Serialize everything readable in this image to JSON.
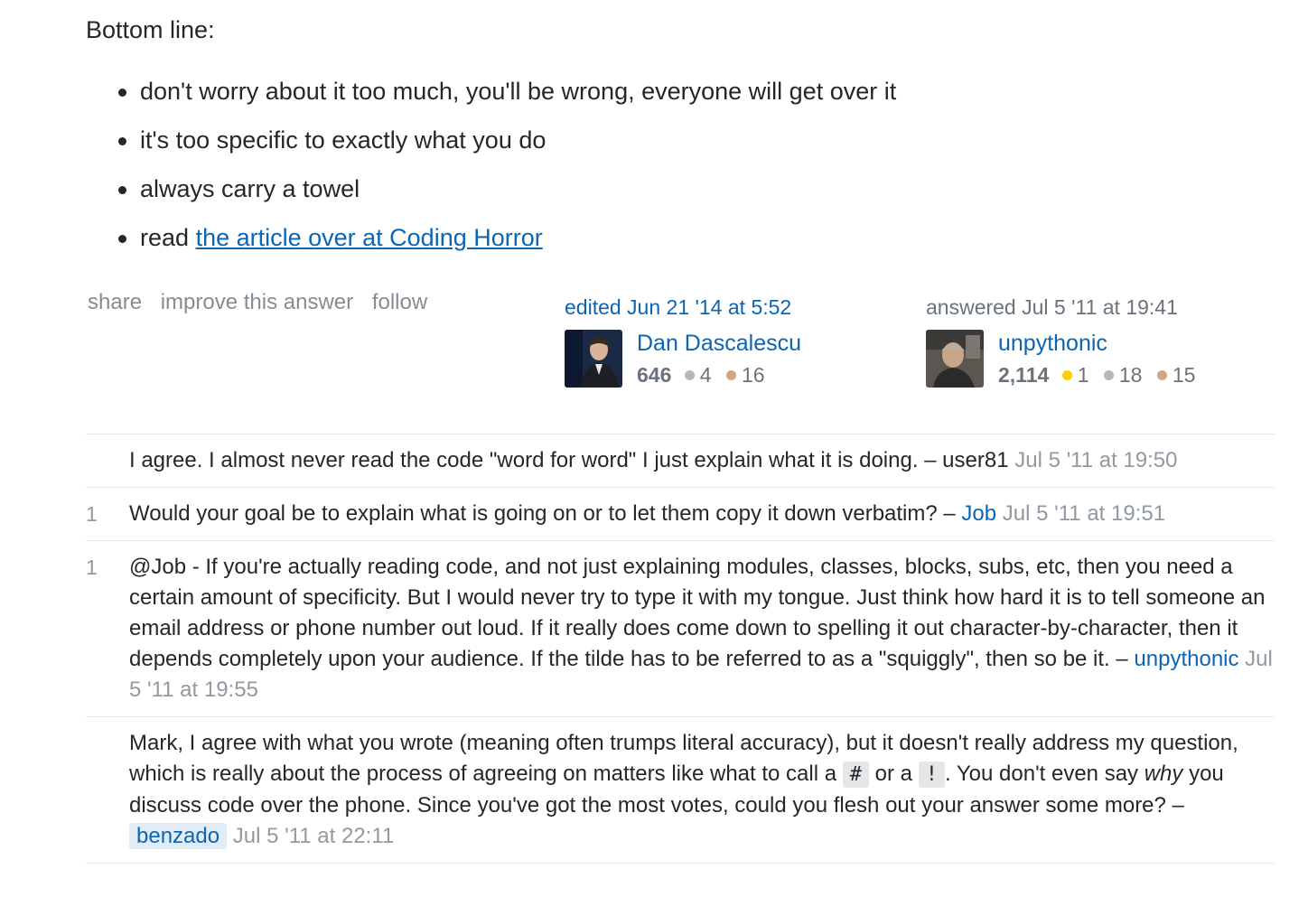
{
  "answer": {
    "intro": "Bottom line:",
    "bullets": [
      "don't worry about it too much, you'll be wrong, everyone will get over it",
      "it's too specific to exactly what you do",
      "always carry a towel"
    ],
    "last_bullet_prefix": "read",
    "last_bullet_link": "the article over at Coding Horror",
    "menu": {
      "share": "share",
      "improve": "improve this answer",
      "follow": "follow"
    },
    "editor": {
      "action": "edited Jun 21 '14 at 5:52",
      "name": "Dan Dascalescu",
      "rep": "646",
      "silver": "4",
      "bronze": "16"
    },
    "author": {
      "action": "answered Jul 5 '11 at 19:41",
      "name": "unpythonic",
      "rep": "2,114",
      "gold": "1",
      "silver": "18",
      "bronze": "15"
    }
  },
  "comments": [
    {
      "score": "",
      "text": "I agree. I almost never read the code \"word for word\" I just explain what it is doing. – user81",
      "date": "Jul 5 '11 at 19:50"
    },
    {
      "score": "1",
      "text": "Would your goal be to explain what is going on or to let them copy it down verbatim? –",
      "user": "Job",
      "date": "Jul 5 '11 at 19:51"
    },
    {
      "score": "1",
      "text": "@Job - If you're actually reading code, and not just explaining modules, classes, blocks, subs, etc, then you need a certain amount of specificity. But I would never try to type it with my tongue. Just think how hard it is to tell someone an email address or phone number out loud. If it really does come down to spelling it out character-by-character, then it depends completely upon your audience. If the tilde has to be referred to as a \"squiggly\", then so be it. –",
      "user": "unpythonic",
      "date": "Jul 5 '11 at 19:55"
    },
    {
      "score": "",
      "text_a": "Mark, I agree with what you wrote (meaning often trumps literal accuracy), but it doesn't really address my question, which is really about the process of agreeing on matters like what to call a",
      "code_hash": "#",
      "text_b": "or a",
      "code_bang": "!",
      "text_c": ". You don't even say",
      "text_em": "why",
      "text_d": "you discuss code over the phone. Since you've got the most votes, could you flesh out your answer some more? –",
      "user": "benzado",
      "date": "Jul 5 '11 at 22:11"
    }
  ]
}
